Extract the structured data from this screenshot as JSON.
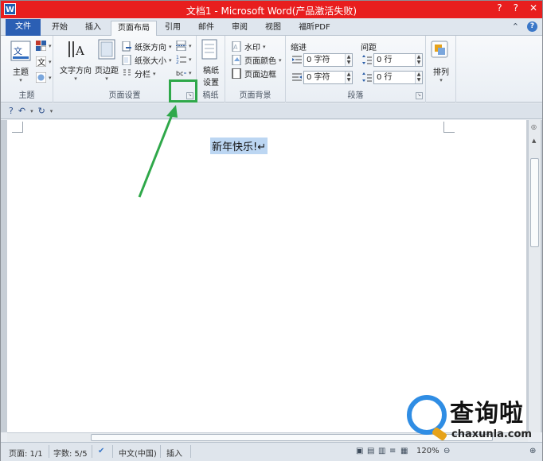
{
  "window": {
    "app_icon": "W",
    "title": "文档1 - Microsoft Word(产品激活失败)",
    "controls": [
      "minimize-icon",
      "maximize-icon",
      "close-icon"
    ]
  },
  "tabs": [
    {
      "label": "文件"
    },
    {
      "label": "开始"
    },
    {
      "label": "插入"
    },
    {
      "label": "页面布局"
    },
    {
      "label": "引用"
    },
    {
      "label": "邮件"
    },
    {
      "label": "审阅"
    },
    {
      "label": "视图"
    },
    {
      "label": "福昕PDF"
    }
  ],
  "ribbon": {
    "theme_group": {
      "label": "主题",
      "theme_button": "主题"
    },
    "page_setup_group": {
      "label": "页面设置",
      "text_direction": "文字方向",
      "margins": "页边距",
      "orientation": "纸张方向",
      "size": "纸张大小",
      "columns": "分栏"
    },
    "draft_group": {
      "label": "稿纸",
      "draft_settings_line1": "稿纸",
      "draft_settings_line2": "设置"
    },
    "background_group": {
      "label": "页面背景",
      "watermark": "水印",
      "page_color": "页面颜色",
      "page_borders": "页面边框"
    },
    "paragraph_group": {
      "label": "段落",
      "indent_label": "缩进",
      "spacing_label": "间距",
      "indent_left": "0 字符",
      "indent_right": "0 字符",
      "spacing_before": "0 行",
      "spacing_after": "0 行"
    },
    "arrange_group": {
      "label": "排列",
      "arrange": "排列"
    }
  },
  "document": {
    "selected_text": "新年快乐!↵"
  },
  "statusbar": {
    "page": "页面: 1/1",
    "words": "字数: 5/5",
    "language": "中文(中国)",
    "mode": "插入",
    "zoom": "120%"
  },
  "watermark": {
    "cn": "查询啦",
    "en": "chaxunla.com"
  },
  "colors": {
    "titlebar": "#e81e1e",
    "file_tab": "#2b5fb4",
    "highlight": "#2fa84a",
    "selection": "#bcd6f2"
  }
}
